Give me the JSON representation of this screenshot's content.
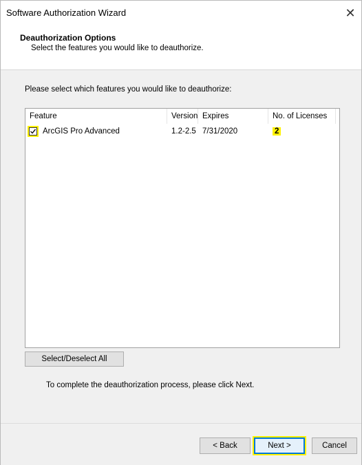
{
  "window": {
    "title": "Software Authorization Wizard",
    "close_glyph": "✕"
  },
  "header": {
    "title": "Deauthorization Options",
    "subtitle": "Select the features you would like to deauthorize."
  },
  "instruction": "Please select which features you would like to deauthorize:",
  "table": {
    "columns": [
      "Feature",
      "Version",
      "Expires",
      "No. of Licenses"
    ],
    "rows": [
      {
        "checked": true,
        "feature": "ArcGIS Pro Advanced",
        "version": "1.2-2.5",
        "expires": "7/31/2020",
        "licenses": "2"
      }
    ]
  },
  "select_all_label": "Select/Deselect All",
  "complete_text": "To complete the deauthorization process, please click Next.",
  "footer": {
    "back_label": "< Back",
    "next_label": "Next >",
    "cancel_label": "Cancel"
  },
  "colors": {
    "highlight": "#fff200",
    "focus_border": "#0078d7",
    "dialog_background": "#f0f0f0"
  },
  "icons": {
    "close": "close-icon",
    "checkbox": "checkbox-checked-icon"
  }
}
